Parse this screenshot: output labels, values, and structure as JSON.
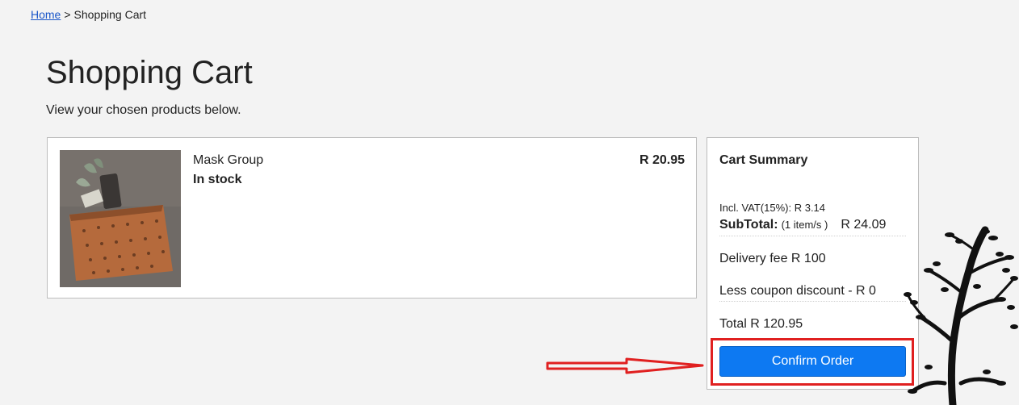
{
  "breadcrumb": {
    "home_label": "Home",
    "separator": ">",
    "current": "Shopping Cart"
  },
  "page": {
    "title": "Shopping Cart",
    "subtitle": "View your chosen products below."
  },
  "cart": {
    "items": [
      {
        "name": "Mask Group",
        "stock_status": "In stock",
        "price": "R 20.95",
        "image_icon": "product-photo-pouch"
      }
    ]
  },
  "summary": {
    "title": "Cart Summary",
    "vat_line": "Incl. VAT(15%): R 3.14",
    "subtotal_label": "SubTotal:",
    "subtotal_items": "(1 item/s )",
    "subtotal_value": "R 24.09",
    "delivery": "Delivery fee R 100",
    "coupon": "Less coupon discount - R 0",
    "total": "Total R 120.95",
    "confirm_label": "Confirm Order"
  },
  "colors": {
    "accent": "#0d79f2",
    "annotation": "#e02020",
    "background": "#f3f3f3"
  }
}
